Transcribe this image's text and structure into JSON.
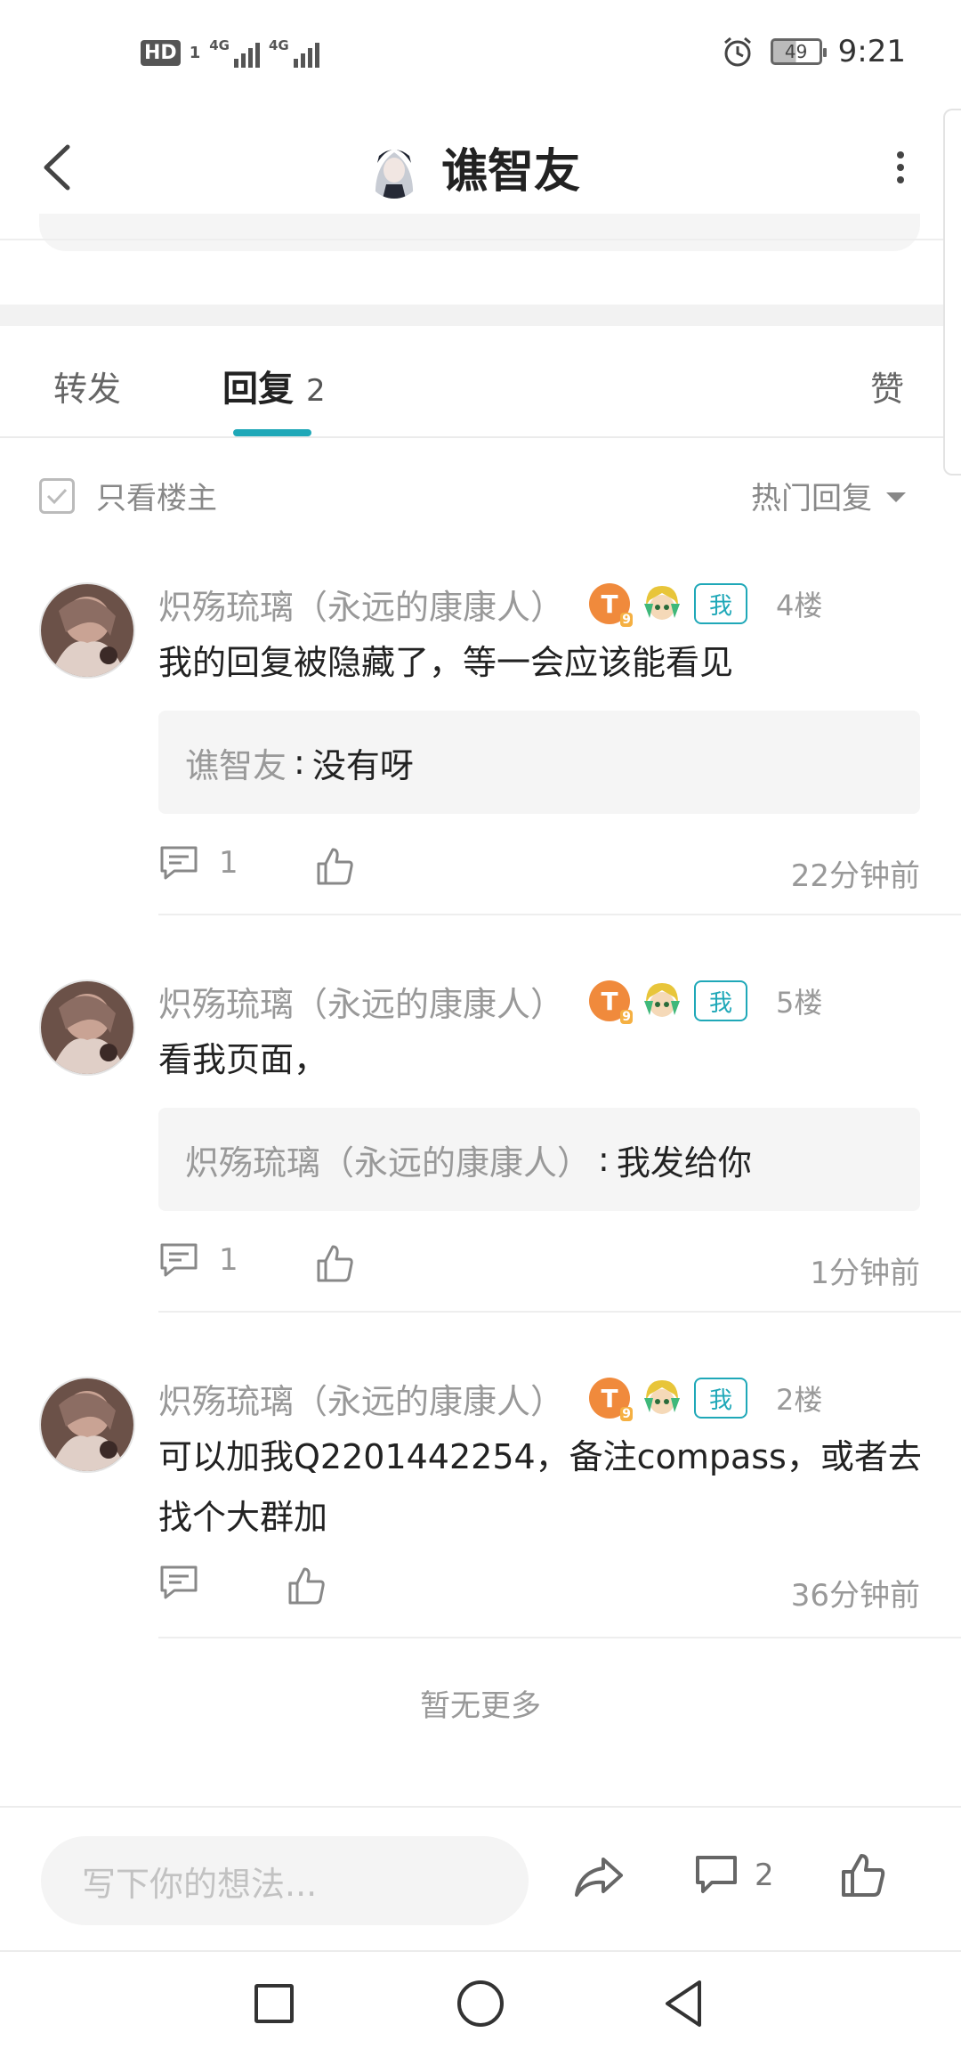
{
  "status_bar": {
    "hd": "HD",
    "hd_sub": "1",
    "sig1_label": "4G",
    "sig2_label": "4G",
    "battery": "49",
    "time": "9:21"
  },
  "header": {
    "title": "谯智友"
  },
  "tabs": {
    "repost": "转发",
    "reply": "回复",
    "reply_count": "2",
    "like": "赞"
  },
  "filter": {
    "only_op": "只看楼主",
    "sort": "热门回复"
  },
  "comments": [
    {
      "name": "炽殇琉璃（永远的康康人）",
      "level_badge": "T",
      "level_sub": "9",
      "me_badge": "我",
      "floor": "4楼",
      "text": "我的回复被隐藏了，等一会应该能看见",
      "quote_user": "谯智友",
      "quote_sep": ":",
      "quote_text": "没有呀",
      "reply_count": "1",
      "time": "22分钟前"
    },
    {
      "name": "炽殇琉璃（永远的康康人）",
      "level_badge": "T",
      "level_sub": "9",
      "me_badge": "我",
      "floor": "5楼",
      "text": "看我页面，",
      "quote_user": "炽殇琉璃（永远的康康人）",
      "quote_sep": ":",
      "quote_text": "我发给你",
      "reply_count": "1",
      "time": "1分钟前"
    },
    {
      "name": "炽殇琉璃（永远的康康人）",
      "level_badge": "T",
      "level_sub": "9",
      "me_badge": "我",
      "floor": "2楼",
      "text": "可以加我Q2201442254，备注compass，或者去找个大群加",
      "reply_count": "",
      "time": "36分钟前"
    }
  ],
  "no_more": "暂无更多",
  "bottom_bar": {
    "placeholder": "写下你的想法...",
    "comment_count": "2"
  },
  "colors": {
    "accent": "#1fa8b8",
    "level_badge": "#f08a3c",
    "text_primary": "#222222",
    "text_secondary": "#999999",
    "quote_bg": "#f5f5f5"
  },
  "icons": {
    "back": "chevron-left-icon",
    "more": "more-vertical-icon",
    "checkbox": "check-icon",
    "reply": "comment-bubble-icon",
    "like": "thumbs-up-icon",
    "share": "share-arrow-icon"
  }
}
